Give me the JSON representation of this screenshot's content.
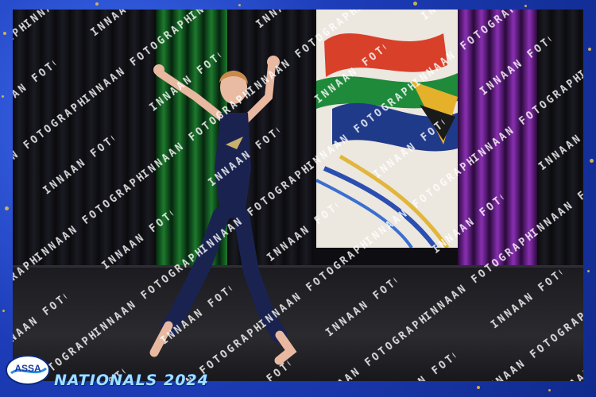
{
  "image": {
    "description_tag": "dancer",
    "watermark_text": "INNAAN FOTOGRAPHY",
    "footer": {
      "logo_text": "ASSA",
      "event_title": "NATIONALS 2024"
    },
    "colors": {
      "frame_blue": "#1d3cb8",
      "glitter_gold": "#e7c34a",
      "leotard_navy": "#1a2350",
      "title_cyan": "#9fe0ff"
    }
  }
}
